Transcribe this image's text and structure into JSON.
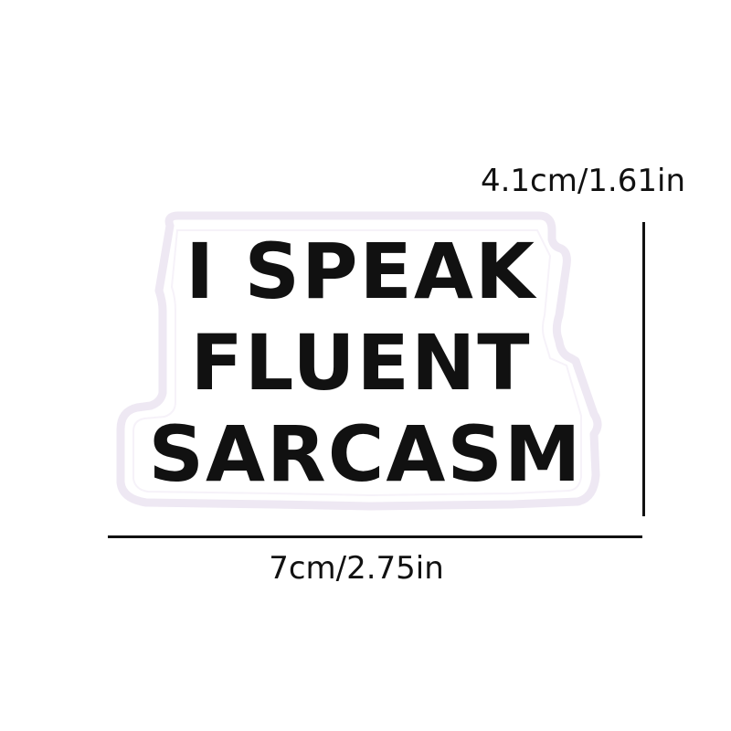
{
  "patch": {
    "line_1": "I SPEAK",
    "line_2": "FLUENT",
    "line_3": "SARCASM",
    "fill_color": "#ffffff",
    "border_color": "#eee8f3",
    "text_color": "#111111"
  },
  "dimensions": {
    "height_label": "4.1cm/1.61in",
    "width_label": "7cm/2.75in",
    "line_color": "#111111"
  }
}
